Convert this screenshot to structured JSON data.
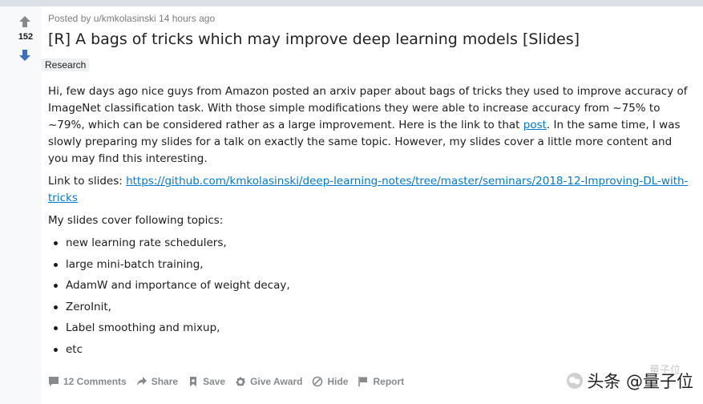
{
  "post": {
    "score": "152",
    "meta": "Posted by u/kmkolasinski 14 hours ago",
    "title": "[R] A bags of tricks which may improve deep learning models [Slides]",
    "flair": "Research",
    "paragraph1_part1": "Hi, few days ago nice guys from Amazon posted an arxiv paper about bags of tricks they used to improve accuracy of ImageNet classification task. With those simple modifications they were able to increase accuracy from ~75% to ~79%, which can be considered rather as a large improvement. Here is the link to that ",
    "paragraph1_link": "post",
    "paragraph1_part2": ". In the same time, I was slowly preparing my slides for a talk on exactly the same topic. However, my slides cover a little more content and you may find this interesting.",
    "slides_label": "Link to slides: ",
    "slides_url": "https://github.com/kmkolasinski/deep-learning-notes/tree/master/seminars/2018-12-Improving-DL-with-tricks",
    "topics_heading": "My slides cover following topics:",
    "topics": [
      "new learning rate schedulers,",
      "large mini-batch training,",
      "AdamW and importance of weight decay,",
      "ZeroInit,",
      "Label smoothing and mixup,",
      "etc"
    ]
  },
  "actions": {
    "comments": "12 Comments",
    "share": "Share",
    "save": "Save",
    "award": "Give Award",
    "hide": "Hide",
    "report": "Report"
  },
  "watermark": {
    "top": "量子位",
    "main": "头条 @量子位"
  },
  "colors": {
    "link": "#0079d3",
    "upvote": "#878a8c",
    "downvote": "#3a6fc4",
    "action": "#878a8c"
  }
}
